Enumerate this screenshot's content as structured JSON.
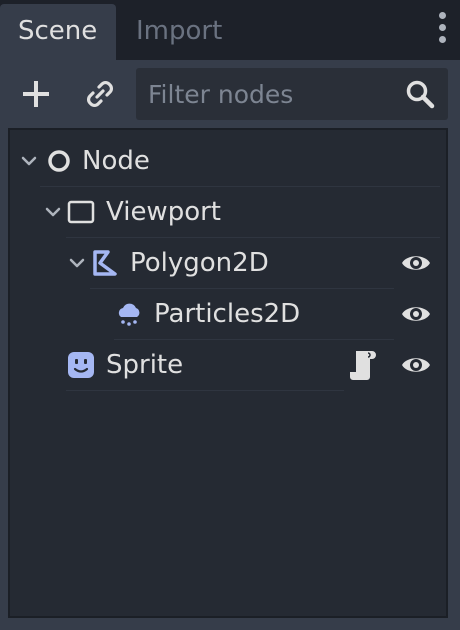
{
  "tabs": [
    {
      "label": "Scene",
      "active": true
    },
    {
      "label": "Import",
      "active": false
    }
  ],
  "toolbar": {
    "add_icon": "plus-icon",
    "link_icon": "link-icon",
    "filter_placeholder": "Filter nodes",
    "filter_value": "",
    "search_icon": "search-icon"
  },
  "tree": {
    "nodes": [
      {
        "label": "Node",
        "icon": "node-circle-icon",
        "depth": 0,
        "expanded": true,
        "visible_toggle": false,
        "script": false
      },
      {
        "label": "Viewport",
        "icon": "viewport-icon",
        "depth": 1,
        "expanded": true,
        "visible_toggle": false,
        "script": false
      },
      {
        "label": "Polygon2D",
        "icon": "polygon2d-icon",
        "depth": 2,
        "expanded": true,
        "visible_toggle": true,
        "script": false
      },
      {
        "label": "Particles2D",
        "icon": "particles2d-icon",
        "depth": 3,
        "expanded": false,
        "visible_toggle": true,
        "script": false
      },
      {
        "label": "Sprite",
        "icon": "sprite-icon",
        "depth": 1,
        "expanded": false,
        "visible_toggle": true,
        "script": true
      }
    ]
  },
  "colors": {
    "node_2d": "#a5b7f3",
    "icon_default": "#e0e0e0",
    "panel_bg": "#363d4a",
    "tree_bg": "#252a33"
  }
}
